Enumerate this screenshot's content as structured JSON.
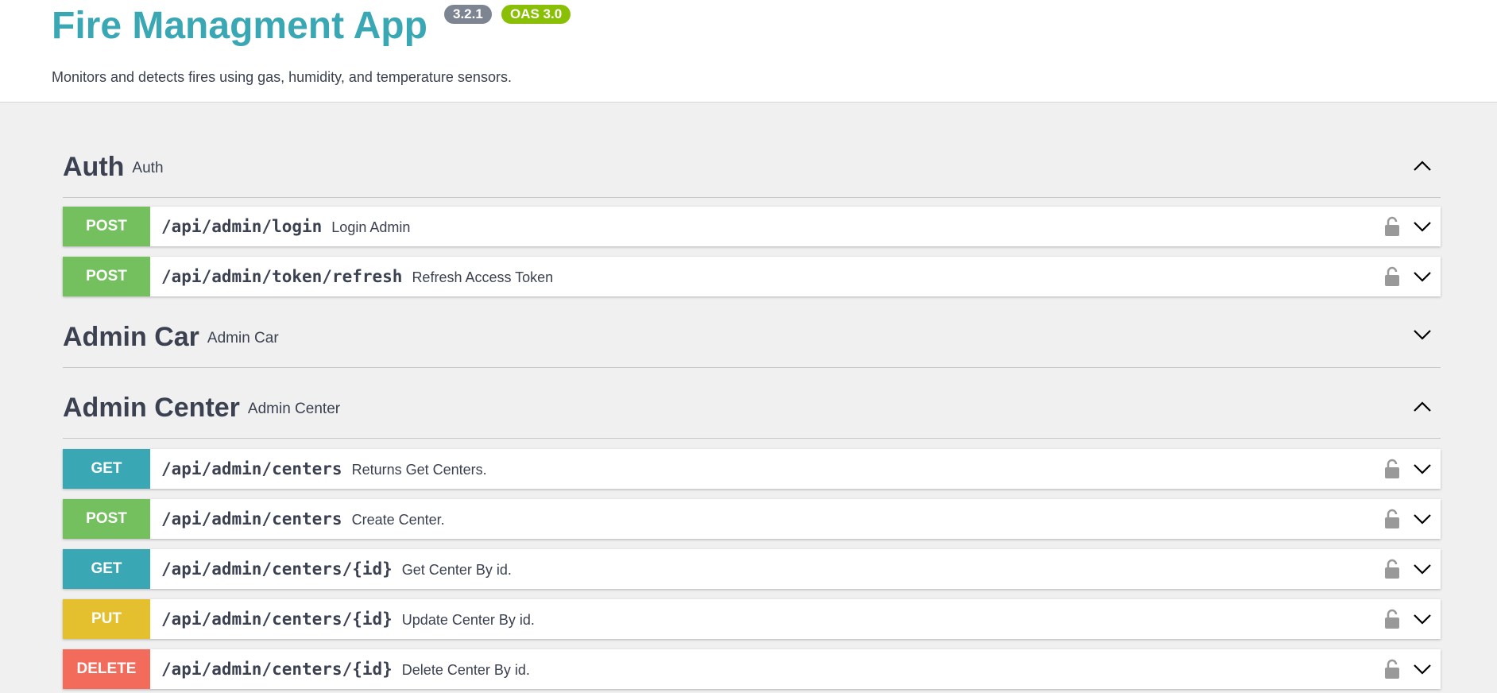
{
  "header": {
    "title": "Fire Managment App",
    "version": "3.2.1",
    "oas": "OAS 3.0",
    "description": "Monitors and detects fires using gas, humidity, and temperature sensors."
  },
  "sections": [
    {
      "name": "Auth",
      "subtitle": "Auth",
      "expanded": true,
      "operations": [
        {
          "method": "POST",
          "path": "/api/admin/login",
          "summary": "Login Admin"
        },
        {
          "method": "POST",
          "path": "/api/admin/token/refresh",
          "summary": "Refresh Access Token"
        }
      ]
    },
    {
      "name": "Admin Car",
      "subtitle": "Admin Car",
      "expanded": false,
      "operations": []
    },
    {
      "name": "Admin Center",
      "subtitle": "Admin Center",
      "expanded": true,
      "operations": [
        {
          "method": "GET",
          "path": "/api/admin/centers",
          "summary": "Returns Get Centers."
        },
        {
          "method": "POST",
          "path": "/api/admin/centers",
          "summary": "Create Center."
        },
        {
          "method": "GET",
          "path": "/api/admin/centers/{id}",
          "summary": "Get Center By id."
        },
        {
          "method": "PUT",
          "path": "/api/admin/centers/{id}",
          "summary": "Update Center By id."
        },
        {
          "method": "DELETE",
          "path": "/api/admin/centers/{id}",
          "summary": "Delete Center By id."
        }
      ]
    }
  ],
  "colors": {
    "post": "#74c05f",
    "get": "#3aa8b4",
    "put": "#e5c02e",
    "delete": "#f26b5b",
    "title": "#3aa8b4",
    "version_badge": "#7d8492",
    "oas_badge": "#89bf04"
  },
  "icons": {
    "expand": "chevron-down-icon",
    "collapse": "chevron-up-icon",
    "auth": "lock-open-icon"
  }
}
